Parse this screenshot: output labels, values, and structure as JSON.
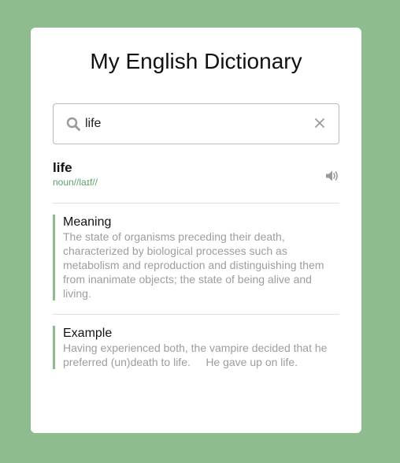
{
  "app": {
    "title": "My English Dictionary"
  },
  "search": {
    "value": "life",
    "placeholder": "",
    "search_icon": "search-icon",
    "clear_icon": "close-icon"
  },
  "result": {
    "word": "life",
    "phonetic": "noun//laɪf//",
    "audio_icon": "volume-icon",
    "meaning": {
      "label": "Meaning",
      "text": "The state of organisms preceding their death, characterized by biological processes such as metabolism and reproduction and distinguishing them from inanimate objects; the state of being alive and living."
    },
    "example": {
      "label": "Example",
      "text": "Having experienced both, the vampire decided that he preferred (un)death to life.     He gave up on life."
    }
  },
  "colors": {
    "background": "#8fbc8f",
    "accent": "#5aa36a",
    "muted_text": "#9d9d9d"
  }
}
